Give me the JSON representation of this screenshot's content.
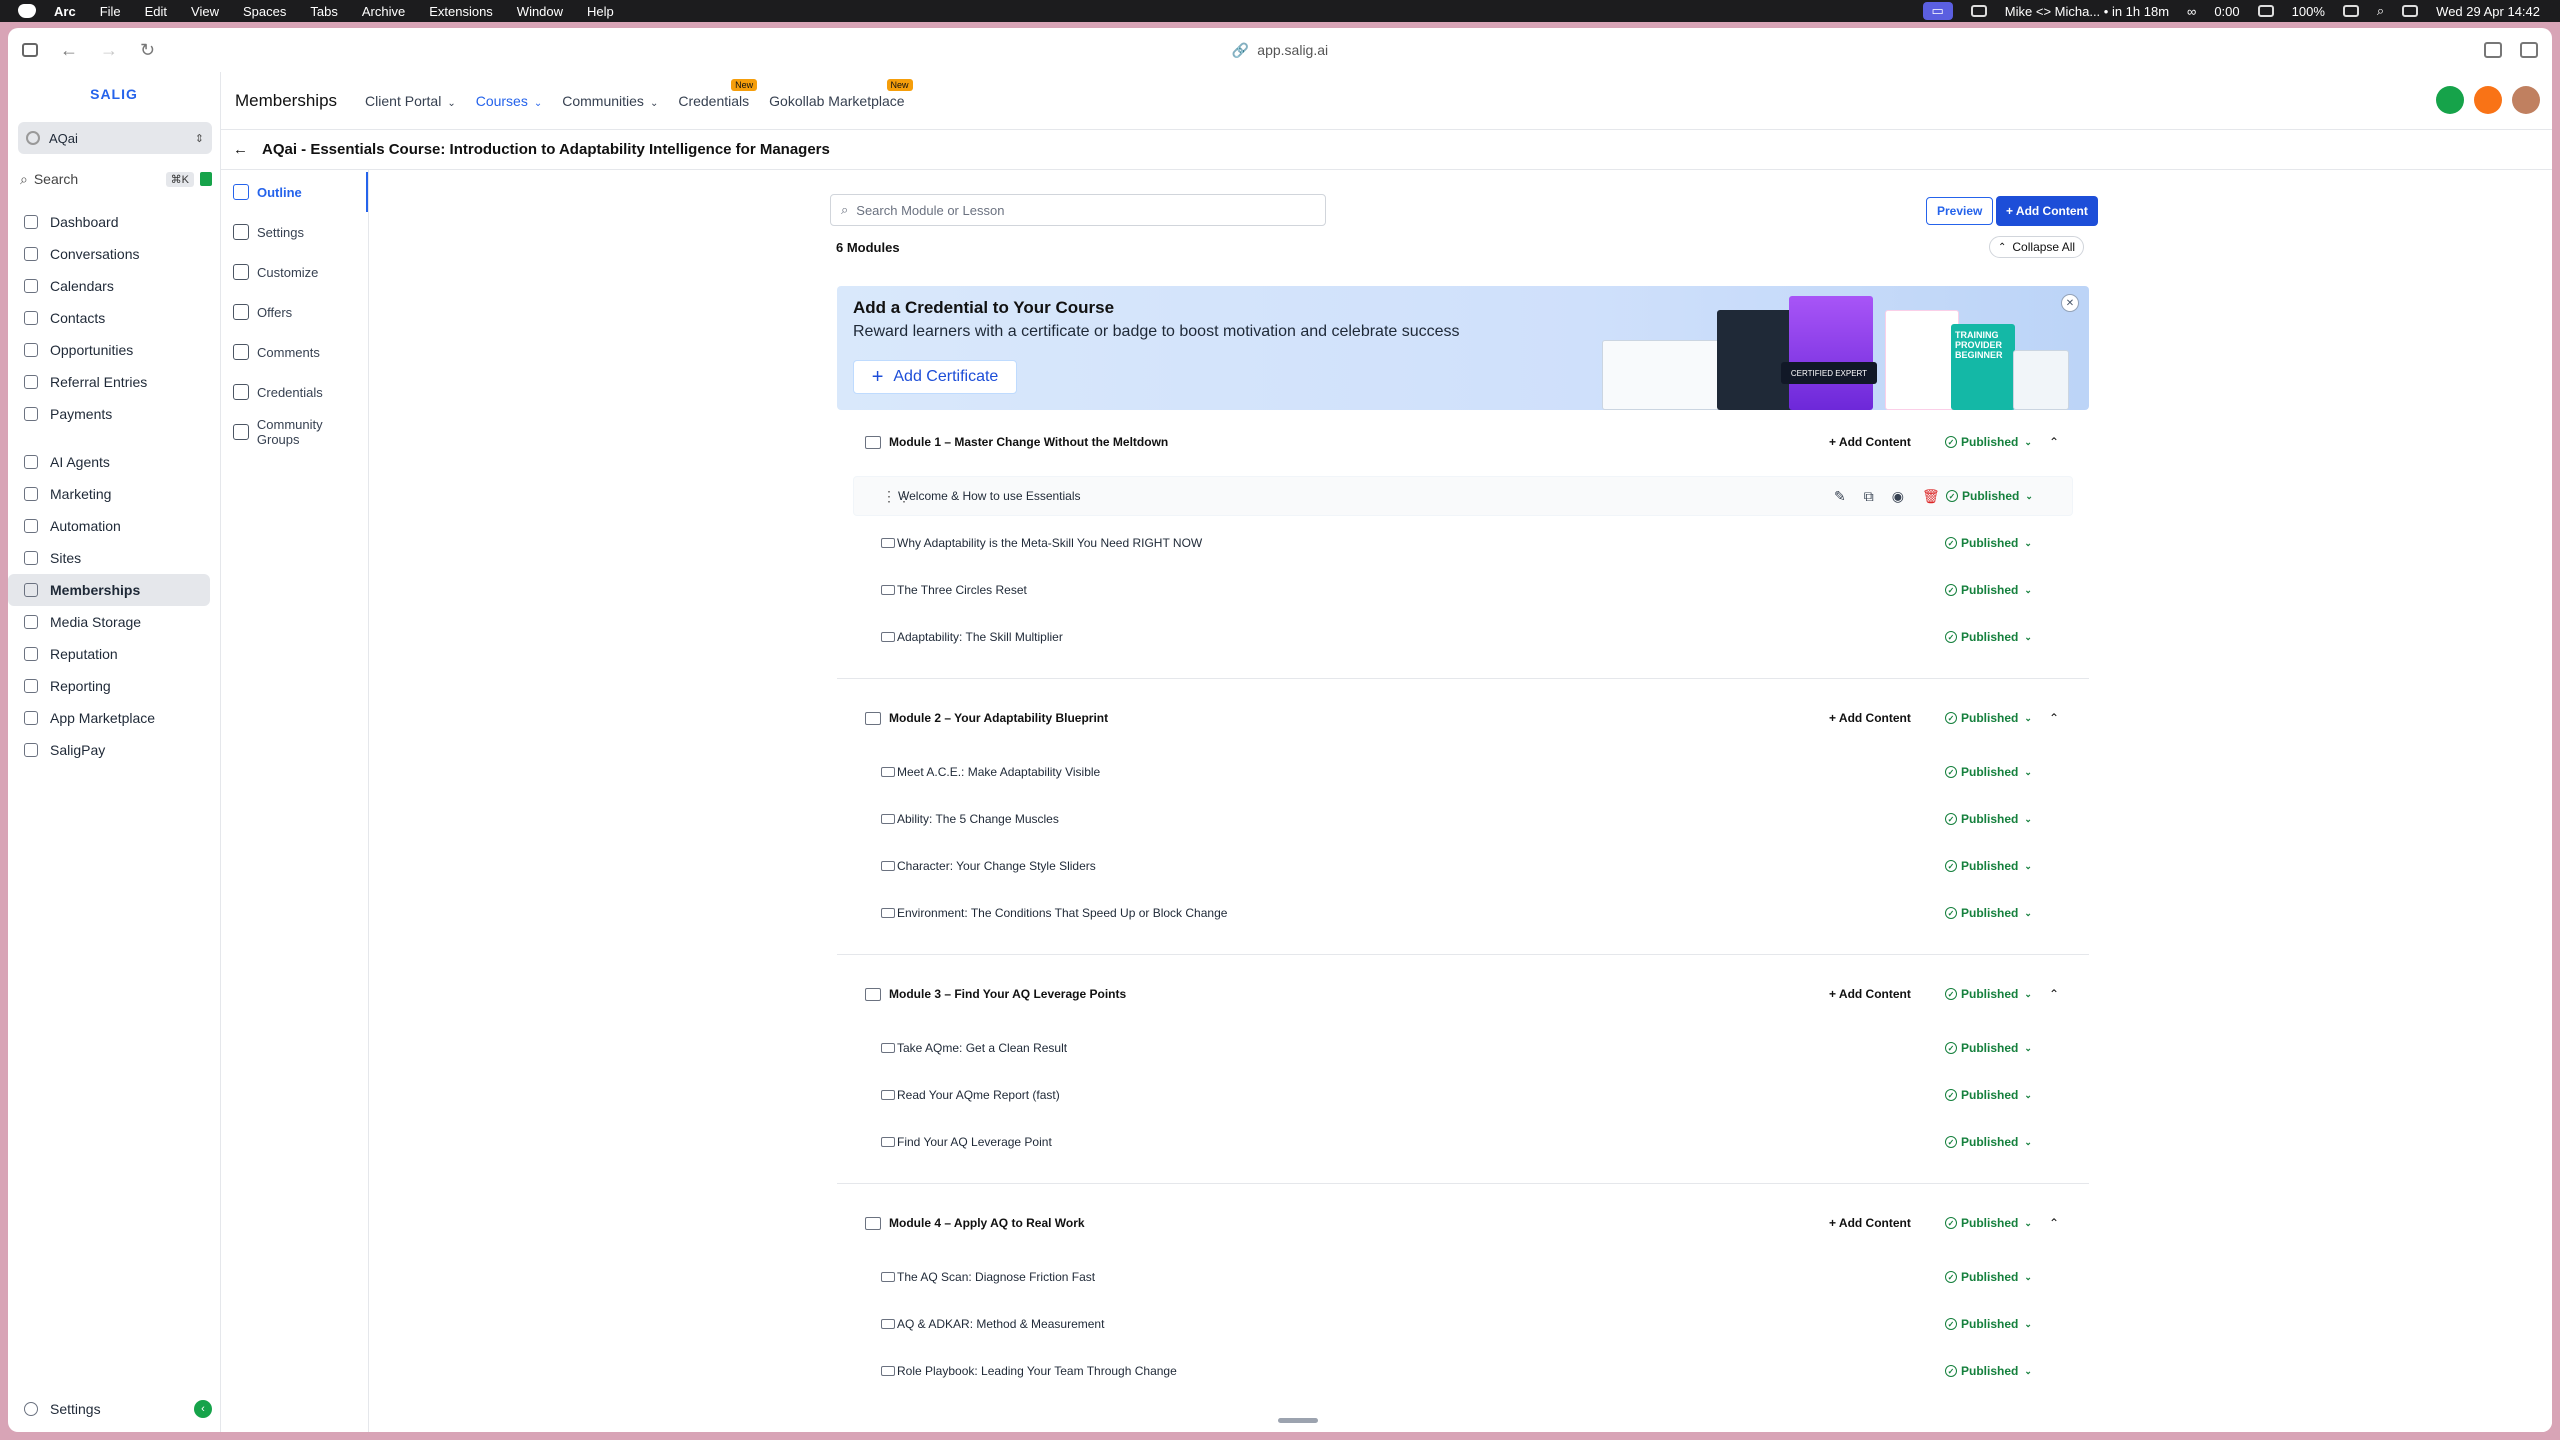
{
  "menubar": {
    "items": [
      "Arc",
      "File",
      "Edit",
      "View",
      "Spaces",
      "Tabs",
      "Archive",
      "Extensions",
      "Window",
      "Help"
    ],
    "event": "Mike <> Micha... • in 1h 18m",
    "timer": "0:00",
    "battery": "100%",
    "datetime": "Wed 29 Apr  14:42"
  },
  "browser": {
    "url": "app.salig.ai"
  },
  "sidebar": {
    "logo": "SALIG",
    "account": "AQai",
    "search_label": "Search",
    "search_kbd": "⌘K",
    "groups": [
      [
        "Dashboard",
        "Conversations",
        "Calendars",
        "Contacts",
        "Opportunities",
        "Referral Entries",
        "Payments"
      ],
      [
        "AI Agents",
        "Marketing",
        "Automation",
        "Sites",
        "Memberships",
        "Media Storage",
        "Reputation",
        "Reporting",
        "App Marketplace",
        "SaligPay"
      ]
    ],
    "active": "Memberships",
    "settings": "Settings"
  },
  "topnav": {
    "title": "Memberships",
    "tabs": [
      {
        "label": "Client Portal",
        "dropdown": true
      },
      {
        "label": "Courses",
        "dropdown": true,
        "active": true
      },
      {
        "label": "Communities",
        "dropdown": true
      },
      {
        "label": "Credentials",
        "badge": "New"
      },
      {
        "label": "Gokollab Marketplace",
        "badge": "New"
      }
    ]
  },
  "breadcrumb": {
    "title": "AQai - Essentials Course: Introduction to Adaptability Intelligence for Managers"
  },
  "subnav": {
    "items": [
      "Outline",
      "Settings",
      "Customize",
      "Offers",
      "Comments",
      "Credentials",
      "Community Groups"
    ],
    "active": "Outline"
  },
  "content": {
    "search_placeholder": "Search Module or Lesson",
    "preview_label": "Preview",
    "add_content_label": "+ Add Content",
    "modules_count": "6 Modules",
    "collapse_all": "Collapse All",
    "banner": {
      "title": "Add a Credential to Your Course",
      "subtitle": "Reward learners with a certificate or badge to boost motivation and celebrate success",
      "button": "Add Certificate",
      "badge_text": "CERTIFIED EXPERT",
      "badge2_text": "TRAINING PROVIDER BEGINNER"
    },
    "module_add_label": "+ Add Content",
    "status_label": "Published",
    "modules": [
      {
        "title": "Module 1 – Master Change Without the Meltdown",
        "lessons": [
          "Welcome & How to use Essentials",
          "Why Adaptability is the Meta-Skill You Need RIGHT NOW",
          "The Three Circles Reset",
          "Adaptability: The Skill Multiplier"
        ]
      },
      {
        "title": "Module 2 – Your Adaptability Blueprint",
        "lessons": [
          "Meet A.C.E.: Make Adaptability Visible",
          "Ability: The 5 Change Muscles",
          "Character: Your Change Style Sliders",
          "Environment: The Conditions That Speed Up or Block Change"
        ]
      },
      {
        "title": "Module 3 – Find Your AQ Leverage Points",
        "lessons": [
          "Take AQme: Get a Clean Result",
          "Read Your AQme Report (fast)",
          "Find Your AQ Leverage Point"
        ]
      },
      {
        "title": "Module 4 – Apply AQ to Real Work",
        "lessons": [
          "The AQ Scan: Diagnose Friction Fast",
          "AQ & ADKAR: Method & Measurement",
          "Role Playbook: Leading Your Team Through Change"
        ]
      }
    ]
  },
  "colors": {
    "accent": "#2563eb",
    "published": "#15803d",
    "danger": "#dc2626",
    "wallpaper": "#d8a4b6"
  }
}
